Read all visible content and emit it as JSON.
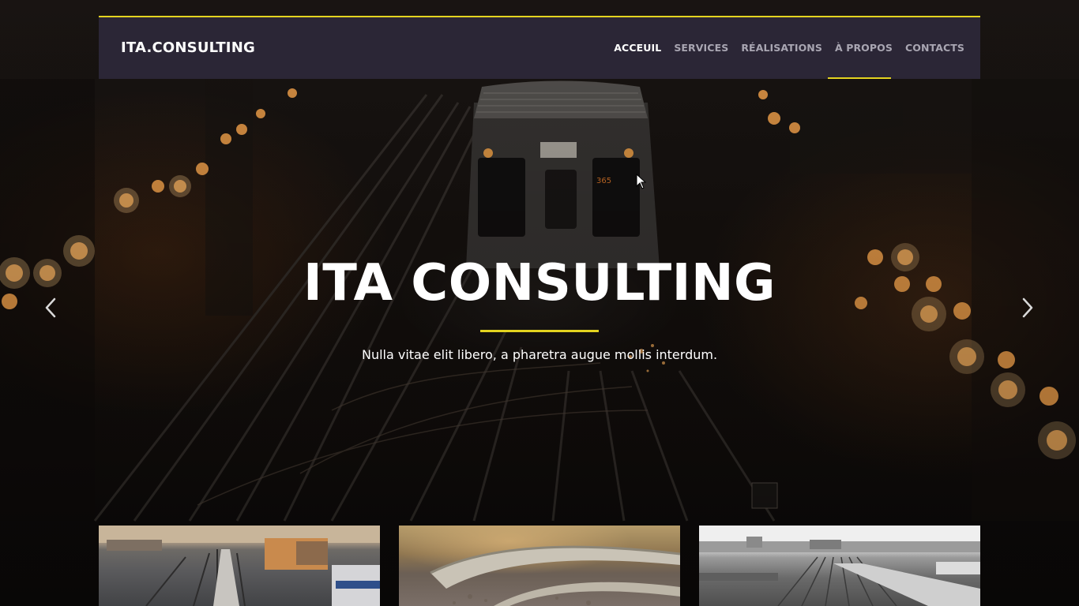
{
  "brand": {
    "name": "ITA.CONSULTING"
  },
  "nav": {
    "items": [
      {
        "label": "ACCEUIL",
        "active": true
      },
      {
        "label": "SERVICES",
        "active": false
      },
      {
        "label": "RÉALISATIONS",
        "active": false
      },
      {
        "label": "À PROPOS",
        "active": false
      },
      {
        "label": "CONTACTS",
        "active": false
      }
    ],
    "hovered_item": "À PROPOS"
  },
  "hero": {
    "title": "ITA CONSULTING",
    "subtitle": "Nulla vitae elit libero, a pharetra augue mollis interdum.",
    "prev_icon": "chevron-left-icon",
    "next_icon": "chevron-right-icon"
  },
  "thumbnails": [
    {
      "icon": "train-yard-photo"
    },
    {
      "icon": "rail-track-closeup-photo"
    },
    {
      "icon": "rail-yard-bw-photo"
    }
  ],
  "colors": {
    "accent": "#e3d31f",
    "navbar": "#2b2636",
    "nav_text": "#a9a6b2",
    "nav_text_active": "#ffffff"
  }
}
